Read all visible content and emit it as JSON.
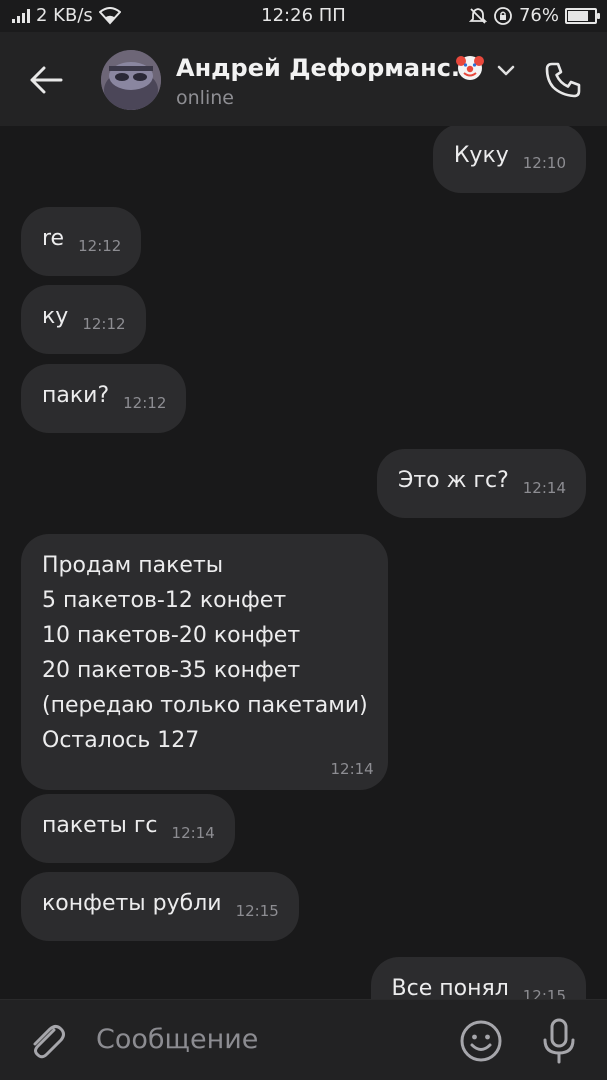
{
  "status_bar": {
    "speed": "2 KB/s",
    "time": "12:26 ПП",
    "battery": "76%",
    "battery_level": 0.76
  },
  "header": {
    "name": "Андрей Деформанс...",
    "status": "online"
  },
  "messages": [
    {
      "text": "Куку",
      "time": "12:10",
      "outgoing": true
    },
    {
      "text": "re",
      "time": "12:12",
      "outgoing": false
    },
    {
      "text": "ку",
      "time": "12:12",
      "outgoing": false
    },
    {
      "text": "паки?",
      "time": "12:12",
      "outgoing": false
    },
    {
      "text": "Это ж гс?",
      "time": "12:14",
      "outgoing": true
    },
    {
      "text": "Продам пакеты\n5 пакетов-12 конфет\n10 пакетов-20 конфет\n20 пакетов-35 конфет\n(передаю только пакетами)\nОсталось 127",
      "time": "12:14",
      "outgoing": false
    },
    {
      "text": "пакеты гс",
      "time": "12:14",
      "outgoing": false
    },
    {
      "text": "конфеты рубли",
      "time": "12:15",
      "outgoing": false
    },
    {
      "text": "Все понял",
      "time": "12:15",
      "outgoing": true
    }
  ],
  "composer": {
    "placeholder": "Сообщение"
  },
  "icons": [
    "signal-icon",
    "wifi-icon",
    "mute-icon",
    "lock-rotation-icon",
    "battery-icon",
    "back-arrow-icon",
    "clown-emoji-icon",
    "chevron-down-icon",
    "phone-icon",
    "paperclip-icon",
    "emoji-icon",
    "microphone-icon"
  ]
}
